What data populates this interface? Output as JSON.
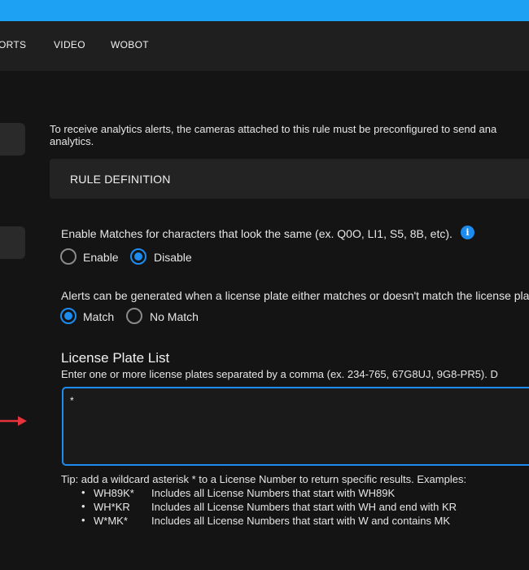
{
  "nav": {
    "items": [
      {
        "label": "PORTS",
        "visible": "ORTS"
      },
      {
        "label": "VIDEO"
      },
      {
        "label": "WOBOT"
      }
    ]
  },
  "intro": {
    "line1": "To receive analytics alerts, the cameras attached to this rule must be preconfigured to send ana",
    "line2": "analytics."
  },
  "rule_definition": {
    "label": "RULE DEFINITION"
  },
  "similar_chars": {
    "label": "Enable Matches for characters that look the same (ex. Q0O, LI1, S5, 8B, etc).",
    "info_icon": "i",
    "options": [
      {
        "label": "Enable",
        "selected": false
      },
      {
        "label": "Disable",
        "selected": true
      }
    ]
  },
  "match_mode": {
    "label": "Alerts can be generated when a license plate either matches or doesn't match the license pla",
    "options": [
      {
        "label": "Match",
        "selected": true
      },
      {
        "label": "No Match",
        "selected": false
      }
    ]
  },
  "plate_list": {
    "title": "License Plate List",
    "description": "Enter one or more license plates separated by a comma (ex. 234-765, 67G8UJ, 9G8-PR5). D",
    "value": "*"
  },
  "tip": {
    "text": "Tip: add a wildcard asterisk * to a License Number to return specific results. Examples:",
    "bullet": "•",
    "examples": [
      {
        "code": "WH89K*",
        "desc": "Includes all License Numbers that start with WH89K"
      },
      {
        "code": "WH*KR",
        "desc": "Includes all License Numbers that start with WH and end with KR"
      },
      {
        "code": "W*MK*",
        "desc": "Includes all License Numbers that start with W and contains MK"
      }
    ]
  },
  "colors": {
    "accent": "#1d8cf0",
    "topbar": "#1da1f2",
    "arrow": "#e8323c"
  }
}
